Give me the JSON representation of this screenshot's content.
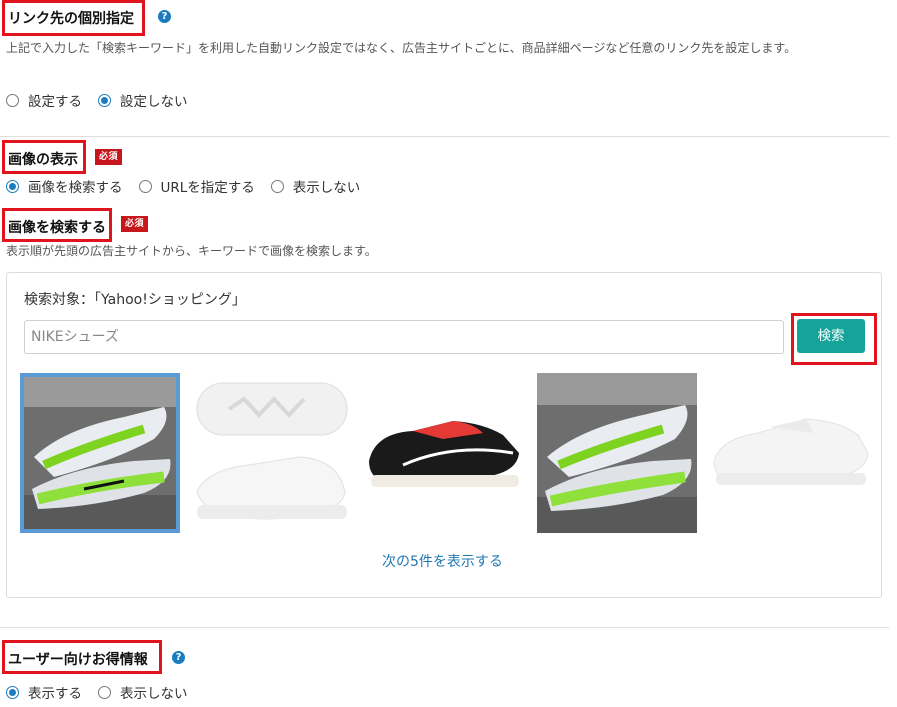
{
  "link_section": {
    "title": "リンク先の個別指定",
    "description": "上記で入力した「検索キーワード」を利用した自動リンク設定ではなく、広告主サイトごとに、商品詳細ページなど任意のリンク先を設定します。",
    "options": [
      "設定する",
      "設定しない"
    ],
    "selected": 1
  },
  "image_display": {
    "title": "画像の表示",
    "badge": "必須",
    "options": [
      "画像を検索する",
      "URLを指定する",
      "表示しない"
    ],
    "selected": 0
  },
  "image_search": {
    "title": "画像を検索する",
    "badge": "必須",
    "description": "表示順が先頭の広告主サイトから、キーワードで画像を検索します。",
    "target": "検索対象：「Yahoo!ショッピング」",
    "input_value": "NIKEシューズ",
    "search_button": "検索",
    "more_link": "次の5件を表示する",
    "selected_image_index": 0
  },
  "deals_section": {
    "title": "ユーザー向けお得情報",
    "options": [
      "表示する",
      "表示しない"
    ],
    "selected": 0
  },
  "colors": {
    "accent": "#1a7bbf",
    "button": "#16a39a",
    "highlight_red": "#e1141e",
    "badge_red": "#c8161d"
  }
}
